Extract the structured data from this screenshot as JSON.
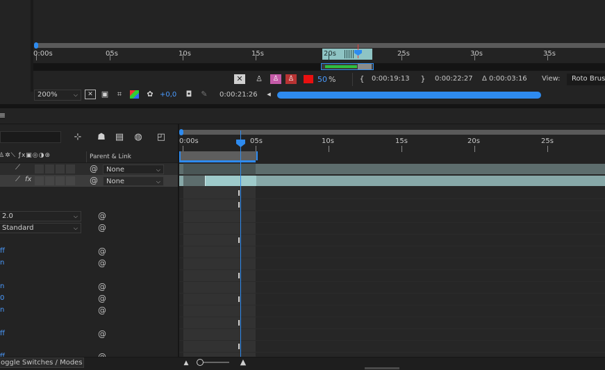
{
  "viewer": {
    "ruler_labels": [
      "0:00s",
      "05s",
      "10s",
      "15s",
      "20s",
      "25s",
      "30s",
      "35s"
    ],
    "fps_percent": "50",
    "percent_sign": "%",
    "time_in": "0:00:19:13",
    "time_out": "0:00:22:27",
    "duration": "Δ 0:00:03:16",
    "view_label": "View:",
    "view_value": "Roto Brus",
    "zoom": "200%",
    "exposure": "+0,0",
    "current_time": "0:00:21:26"
  },
  "timeline": {
    "menu_icon": "≡",
    "header_parent_link": "Parent & Link",
    "ruler_labels": [
      "0:00s",
      "05s",
      "10s",
      "15s",
      "20s",
      "25s"
    ],
    "layer_parents": [
      "None",
      "None"
    ],
    "property_values": [
      "2.0",
      "Standard"
    ],
    "blue_values": [
      "ff",
      "n",
      "n",
      "0",
      "n",
      "ff",
      "ff"
    ],
    "toggle_label": "oggle Switches / Modes"
  },
  "colors": {
    "accent": "#2e8bef",
    "range": "#8ec4c4",
    "green": "#2fbf3f",
    "red": "#e81010"
  }
}
